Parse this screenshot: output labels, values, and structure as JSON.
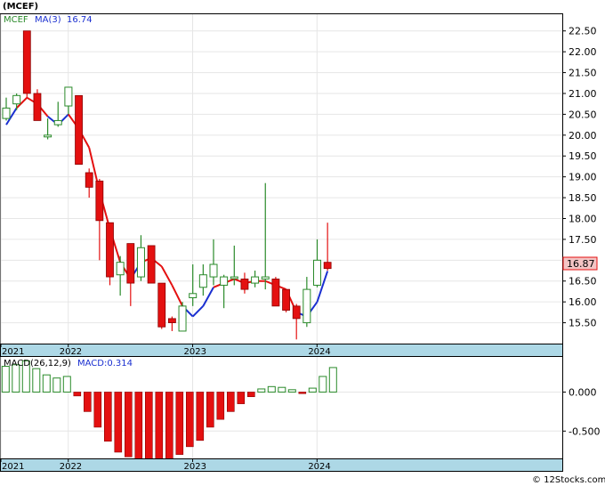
{
  "header": {
    "title": "(MCEF)",
    "ma_ticker": "MCEF",
    "ma_label": "MA(3)",
    "ma_value": "16.74",
    "macd_label": "MACD(26,12,9)",
    "macd_value_label": "MACD:0.314",
    "price_tag": "16.87",
    "watermark": "© 12Stocks.com"
  },
  "colors": {
    "up_candle": "#2a8a2a",
    "down_candle": "#e41010",
    "ma_up": "#1a2fd0",
    "ma_down": "#e41010",
    "macd_pos": "#2a8a2a",
    "macd_neg": "#e41010",
    "date_band": "#add8e6",
    "price_tag_bg": "#f3c4c4"
  },
  "chart_data": [
    {
      "type": "candlestick",
      "title": "(MCEF)",
      "ylim": [
        15.0,
        22.9
      ],
      "grid": true,
      "y_ticks": [
        "15.50",
        "16.00",
        "16.50",
        "17.00",
        "17.50",
        "18.00",
        "18.50",
        "19.00",
        "19.50",
        "20.00",
        "20.50",
        "21.00",
        "21.50",
        "22.00",
        "22.50"
      ],
      "x_ticks": [
        "2021",
        "2022",
        "2023",
        "2024"
      ],
      "x_tick_positions": [
        0,
        6.5,
        18.5,
        30.5
      ],
      "candles": [
        {
          "o": 20.4,
          "h": 20.9,
          "l": 20.35,
          "c": 20.65
        },
        {
          "o": 20.75,
          "h": 21.0,
          "l": 20.6,
          "c": 20.95
        },
        {
          "o": 22.5,
          "h": 22.5,
          "l": 20.9,
          "c": 21.0
        },
        {
          "o": 21.0,
          "h": 21.1,
          "l": 20.35,
          "c": 20.35
        },
        {
          "o": 20.0,
          "h": 20.4,
          "l": 19.9,
          "c": 20.0
        },
        {
          "o": 20.25,
          "h": 20.8,
          "l": 20.2,
          "c": 20.35
        },
        {
          "o": 20.7,
          "h": 21.15,
          "l": 20.5,
          "c": 21.15
        },
        {
          "o": 20.95,
          "h": 20.95,
          "l": 19.3,
          "c": 19.3
        },
        {
          "o": 19.1,
          "h": 19.2,
          "l": 18.5,
          "c": 18.75
        },
        {
          "o": 18.9,
          "h": 18.95,
          "l": 17.0,
          "c": 17.95
        },
        {
          "o": 17.9,
          "h": 17.9,
          "l": 16.4,
          "c": 16.6
        },
        {
          "o": 16.65,
          "h": 17.1,
          "l": 16.15,
          "c": 16.95
        },
        {
          "o": 17.4,
          "h": 17.4,
          "l": 15.9,
          "c": 16.45
        },
        {
          "o": 16.6,
          "h": 17.6,
          "l": 16.5,
          "c": 17.3
        },
        {
          "o": 17.35,
          "h": 17.35,
          "l": 16.45,
          "c": 16.45
        },
        {
          "o": 16.45,
          "h": 16.45,
          "l": 15.35,
          "c": 15.4
        },
        {
          "o": 15.6,
          "h": 15.65,
          "l": 15.3,
          "c": 15.5
        },
        {
          "o": 15.3,
          "h": 16.0,
          "l": 15.3,
          "c": 15.9
        },
        {
          "o": 16.1,
          "h": 16.9,
          "l": 15.9,
          "c": 16.2
        },
        {
          "o": 16.35,
          "h": 16.9,
          "l": 16.15,
          "c": 16.65
        },
        {
          "o": 16.6,
          "h": 17.5,
          "l": 16.4,
          "c": 16.9
        },
        {
          "o": 16.4,
          "h": 16.65,
          "l": 15.85,
          "c": 16.6
        },
        {
          "o": 16.6,
          "h": 17.35,
          "l": 16.4,
          "c": 16.6
        },
        {
          "o": 16.55,
          "h": 16.7,
          "l": 16.2,
          "c": 16.3
        },
        {
          "o": 16.45,
          "h": 16.75,
          "l": 16.35,
          "c": 16.6
        },
        {
          "o": 16.55,
          "h": 18.85,
          "l": 16.3,
          "c": 16.6
        },
        {
          "o": 16.55,
          "h": 16.6,
          "l": 15.9,
          "c": 15.9
        },
        {
          "o": 16.3,
          "h": 16.3,
          "l": 15.75,
          "c": 15.8
        },
        {
          "o": 15.9,
          "h": 15.95,
          "l": 15.1,
          "c": 15.6
        },
        {
          "o": 15.5,
          "h": 16.6,
          "l": 15.4,
          "c": 16.3
        },
        {
          "o": 16.4,
          "h": 17.5,
          "l": 16.35,
          "c": 17.0
        },
        {
          "o": 16.95,
          "h": 17.9,
          "l": 16.75,
          "c": 16.8
        }
      ],
      "ma": {
        "name": "MA(3)",
        "values": [
          20.25,
          20.65,
          20.9,
          20.75,
          20.45,
          20.25,
          20.5,
          20.15,
          19.7,
          18.65,
          17.75,
          16.95,
          16.55,
          16.95,
          17.05,
          16.85,
          16.4,
          15.9,
          15.65,
          15.9,
          16.35,
          16.45,
          16.55,
          16.45,
          16.5,
          16.5,
          16.4,
          16.3,
          15.75,
          15.65,
          16.0,
          16.74
        ],
        "color_direction": [
          "up",
          "up",
          "down",
          "down",
          "down",
          "up",
          "up",
          "down",
          "down",
          "down",
          "down",
          "down",
          "down",
          "up",
          "down",
          "down",
          "down",
          "down",
          "up",
          "up",
          "up",
          "down",
          "down",
          "down",
          "down",
          "down",
          "down",
          "down",
          "down",
          "up",
          "up",
          "up"
        ]
      }
    },
    {
      "type": "bar",
      "title": "MACD(26,12,9)",
      "ylim": [
        -0.85,
        0.45
      ],
      "y_ticks": [
        "0.000",
        "-0.500"
      ],
      "x_ticks": [
        "2021",
        "2022",
        "2023",
        "2024"
      ],
      "values": [
        0.33,
        0.35,
        0.4,
        0.3,
        0.22,
        0.18,
        0.2,
        -0.05,
        -0.25,
        -0.45,
        -0.63,
        -0.77,
        -0.83,
        -0.86,
        -0.86,
        -0.86,
        -0.86,
        -0.8,
        -0.7,
        -0.62,
        -0.45,
        -0.35,
        -0.25,
        -0.15,
        -0.06,
        0.04,
        0.07,
        0.06,
        0.03,
        -0.02,
        0.05,
        0.2,
        0.314
      ]
    }
  ]
}
